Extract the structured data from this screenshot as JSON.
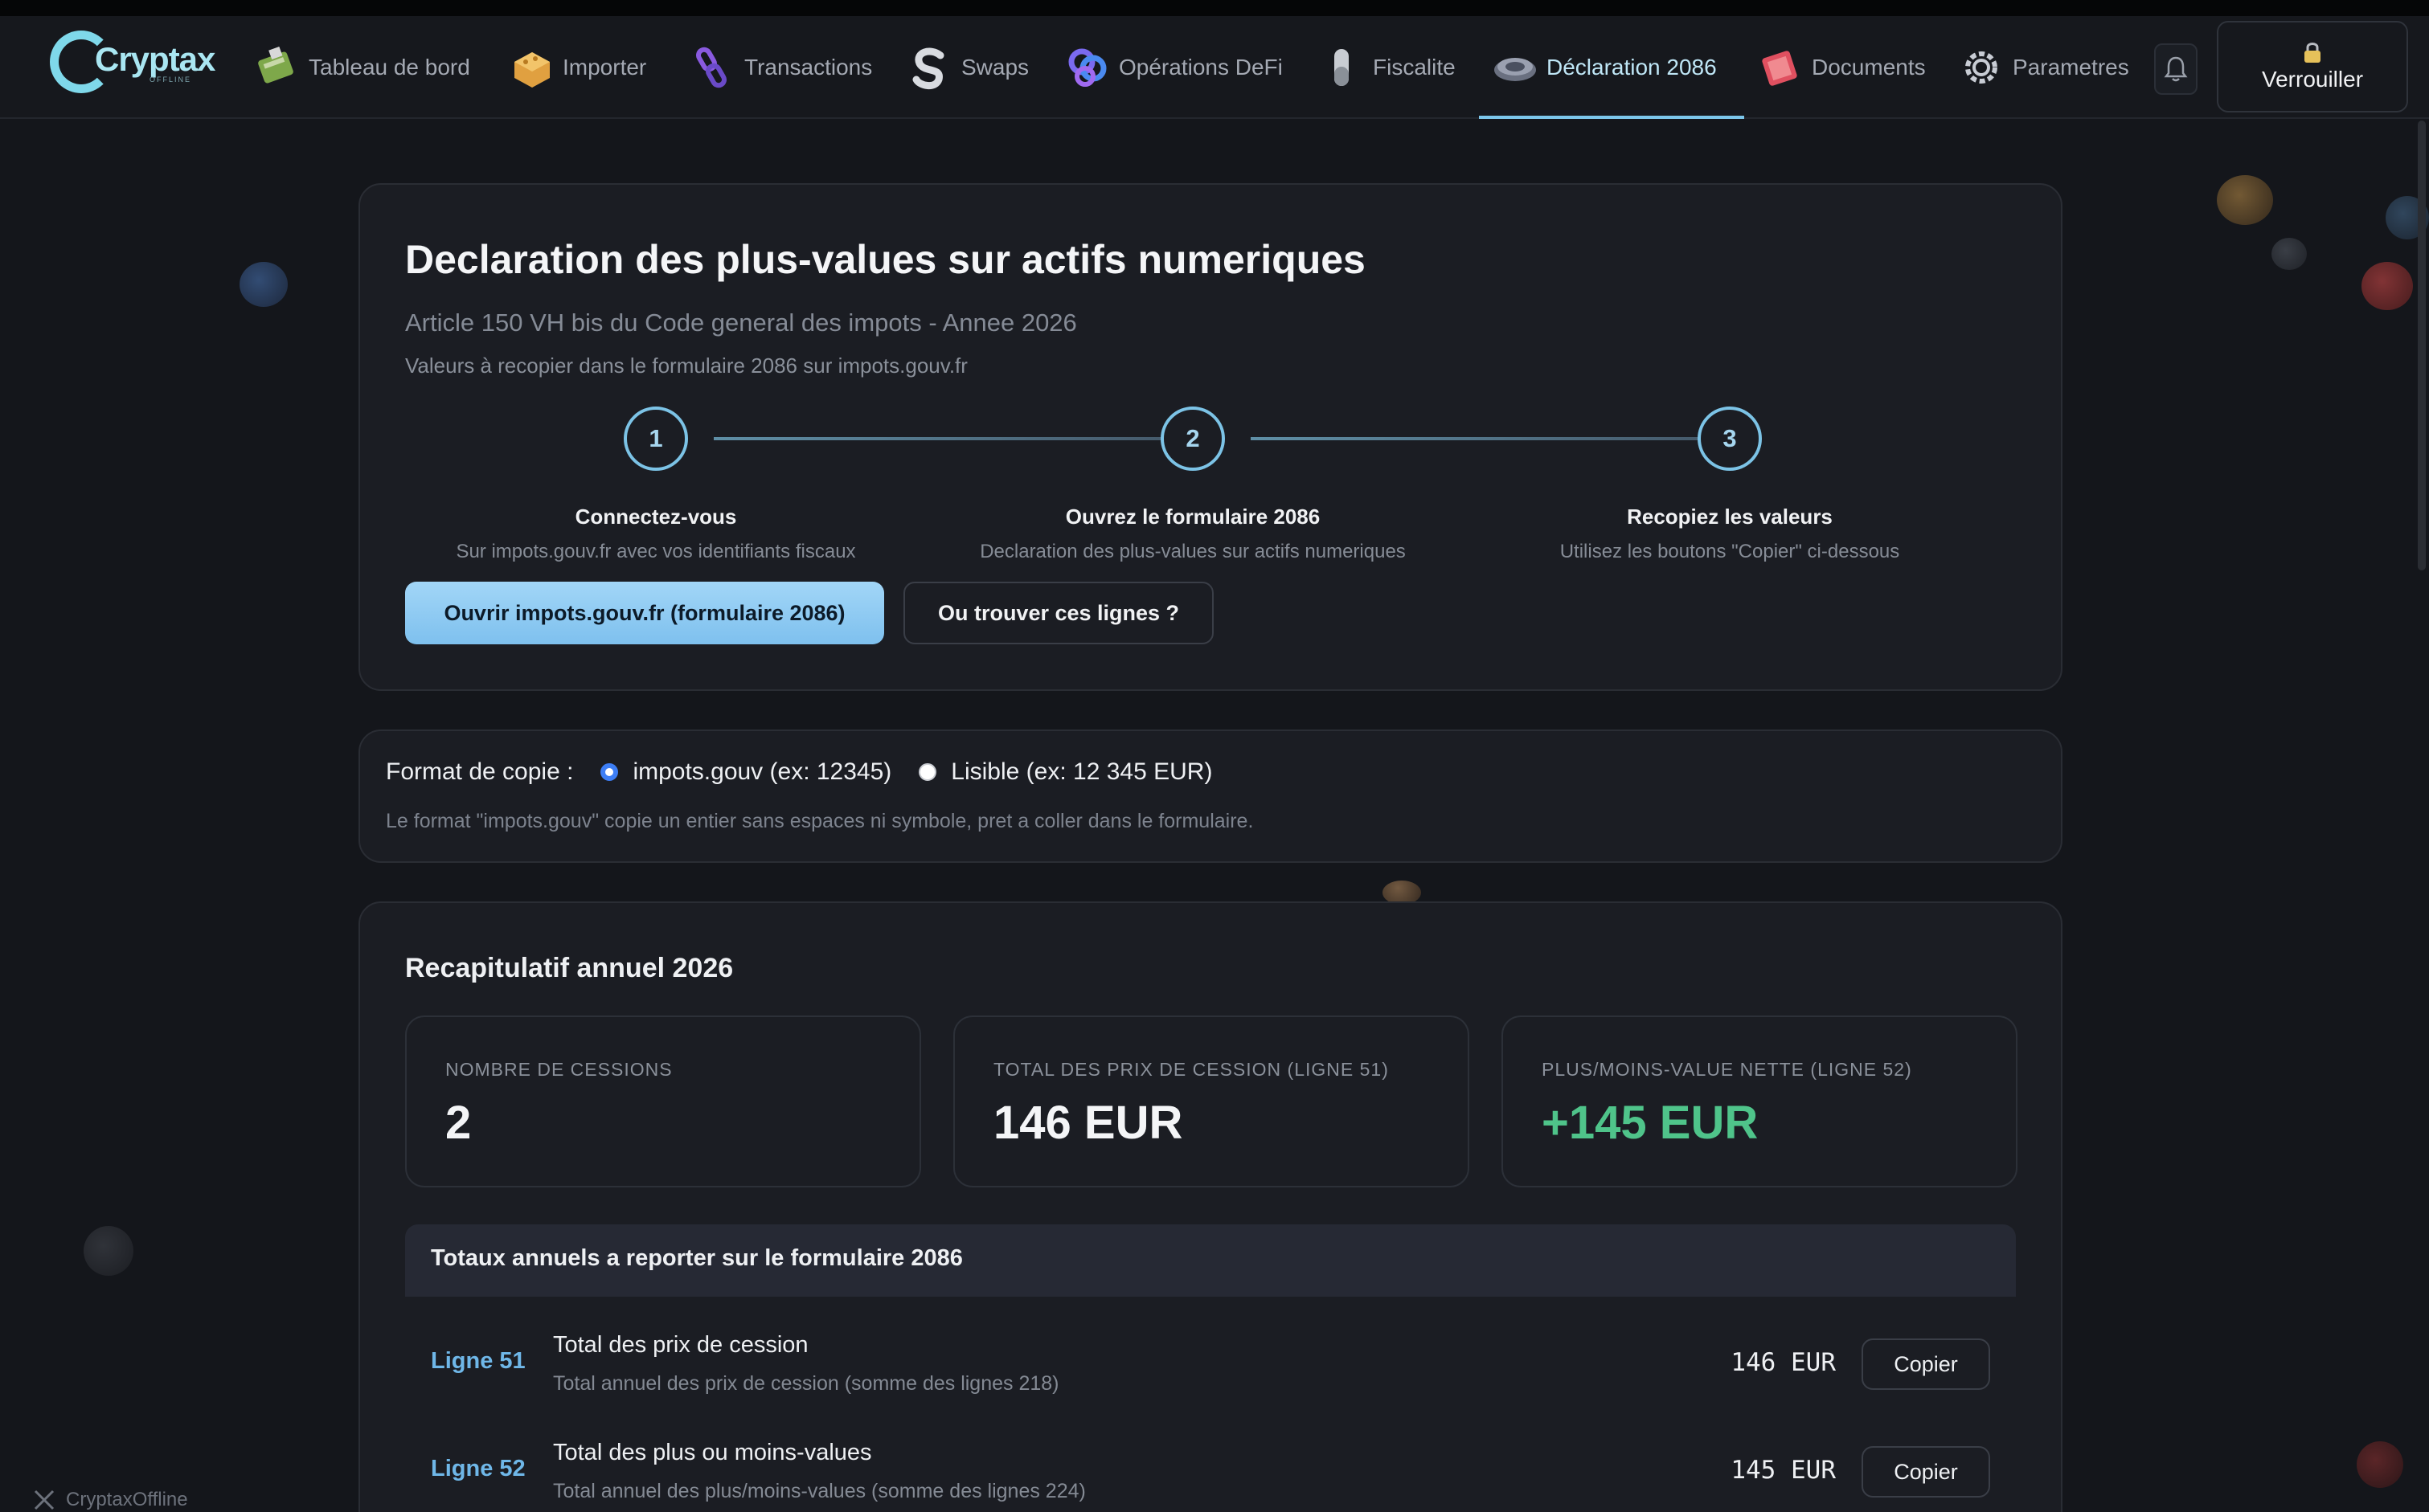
{
  "app": {
    "logo_text": "Cryptax",
    "logo_sub": "OFFLINE"
  },
  "nav": {
    "items": [
      {
        "label": "Tableau de bord",
        "icon": "dashboard-icon"
      },
      {
        "label": "Importer",
        "icon": "import-icon"
      },
      {
        "label": "Transactions",
        "icon": "transactions-icon"
      },
      {
        "label": "Swaps",
        "icon": "swap-icon"
      },
      {
        "label": "Opérations DeFi",
        "icon": "defi-icon"
      },
      {
        "label": "Fiscalite",
        "icon": "tax-icon"
      },
      {
        "label": "Déclaration 2086",
        "icon": "declaration-icon",
        "active": true
      },
      {
        "label": "Documents",
        "icon": "documents-icon"
      },
      {
        "label": "Parametres",
        "icon": "gear-icon"
      }
    ],
    "lock_label": "Verrouiller"
  },
  "declaration": {
    "title": "Declaration des plus-values sur actifs numeriques",
    "subtitle": "Article 150 VH bis du Code general des impots - Annee 2026",
    "hint": "Valeurs à recopier dans le formulaire 2086 sur impots.gouv.fr",
    "steps": [
      {
        "num": "1",
        "title": "Connectez-vous",
        "desc": "Sur impots.gouv.fr avec vos identifiants fiscaux"
      },
      {
        "num": "2",
        "title": "Ouvrez le formulaire 2086",
        "desc": "Declaration des plus-values sur actifs numeriques"
      },
      {
        "num": "3",
        "title": "Recopiez les valeurs",
        "desc": "Utilisez les boutons \"Copier\" ci-dessous"
      }
    ],
    "open_button": "Ouvrir impots.gouv.fr (formulaire 2086)",
    "where_button": "Ou trouver ces lignes ?"
  },
  "copy_format": {
    "label": "Format de copie :",
    "options": [
      {
        "label": "impots.gouv (ex: 12345)",
        "selected": true
      },
      {
        "label": "Lisible (ex: 12 345 EUR)",
        "selected": false
      }
    ],
    "note": "Le format \"impots.gouv\" copie un entier sans espaces ni symbole, pret a coller dans le formulaire."
  },
  "summary": {
    "title": "Recapitulatif annuel 2026",
    "stats": [
      {
        "label": "NOMBRE DE CESSIONS",
        "value": "2"
      },
      {
        "label": "TOTAL DES PRIX DE CESSION (LIGNE 51)",
        "value": "146 EUR"
      },
      {
        "label": "PLUS/MOINS-VALUE NETTE (LIGNE 52)",
        "value": "+145 EUR",
        "color": "#4fc48a"
      }
    ],
    "totals_title": "Totaux annuels a reporter sur le formulaire 2086",
    "rows": [
      {
        "ref": "Ligne 51",
        "title": "Total des prix de cession",
        "desc": "Total annuel des prix de cession (somme des lignes 218)",
        "value": "146 EUR",
        "copy": "Copier"
      },
      {
        "ref": "Ligne 52",
        "title": "Total des plus ou moins-values",
        "desc": "Total annuel des plus/moins-values (somme des lignes 224)",
        "value": "145 EUR",
        "copy": "Copier"
      }
    ]
  },
  "footer": {
    "twitter_handle": "CryptaxOffline"
  },
  "colors": {
    "accent": "#7cc6ea",
    "positive": "#4fc48a",
    "background": "#14161b"
  }
}
